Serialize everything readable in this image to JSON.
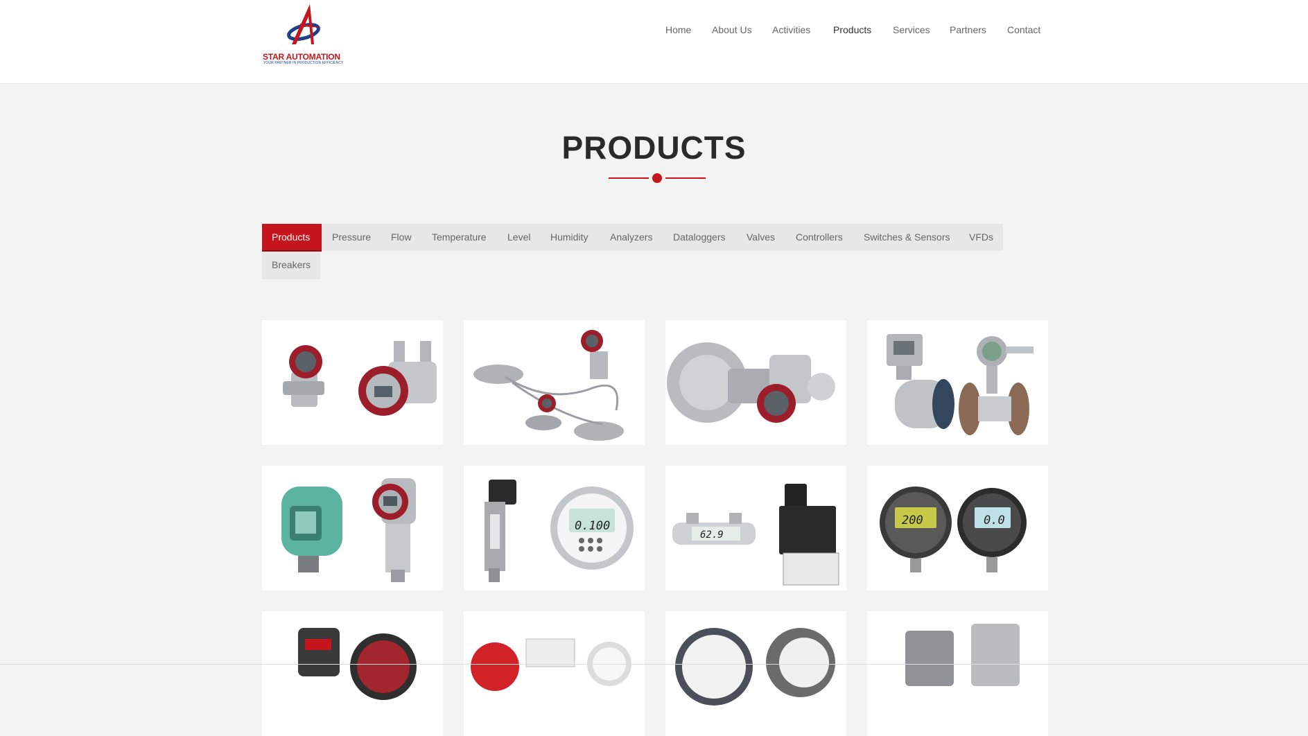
{
  "header": {
    "logo": {
      "name": "STAR AUTOMATION",
      "tagline": "YOUR PARTNER IN PRODUCTION EFFICIENCY",
      "colors": {
        "red": "#c4161c",
        "blue": "#1f3f8a"
      }
    },
    "nav": [
      {
        "label": "Home",
        "active": false
      },
      {
        "label": "About Us",
        "active": false
      },
      {
        "label": "Activities",
        "active": false
      },
      {
        "label": "Products",
        "active": true
      },
      {
        "label": "Services",
        "active": false
      },
      {
        "label": "Partners",
        "active": false
      },
      {
        "label": "Contact",
        "active": false
      }
    ]
  },
  "page": {
    "title": "PRODUCTS",
    "accent_color": "#c4161c"
  },
  "tabs": [
    {
      "label": "Products",
      "active": true
    },
    {
      "label": "Pressure"
    },
    {
      "label": "Flow"
    },
    {
      "label": "Temperature"
    },
    {
      "label": "Level"
    },
    {
      "label": "Humidity"
    },
    {
      "label": "Analyzers"
    },
    {
      "label": "Dataloggers"
    },
    {
      "label": "Valves"
    },
    {
      "label": "Controllers"
    },
    {
      "label": "Switches & Sensors"
    },
    {
      "label": "VFDs"
    },
    {
      "label": "Breakers"
    }
  ],
  "products": [
    {
      "icon": "pressure-transmitters-pair-image"
    },
    {
      "icon": "remote-seal-transmitters-image"
    },
    {
      "icon": "flange-level-transmitter-image"
    },
    {
      "icon": "electromagnetic-flowmeters-image"
    },
    {
      "icon": "green-transmitter-pair-image"
    },
    {
      "icon": "digital-pressure-gauge-transducer-image"
    },
    {
      "icon": "differential-pressure-indicator-image"
    },
    {
      "icon": "digital-pressure-gauges-image"
    },
    {
      "icon": "controller-and-gauge-image"
    },
    {
      "icon": "gauges-and-controllers-image"
    },
    {
      "icon": "dial-gauges-image"
    },
    {
      "icon": "explosion-proof-enclosures-image"
    }
  ],
  "gauge_readouts": [
    "0.100",
    "62.9",
    "200",
    "0.0"
  ]
}
